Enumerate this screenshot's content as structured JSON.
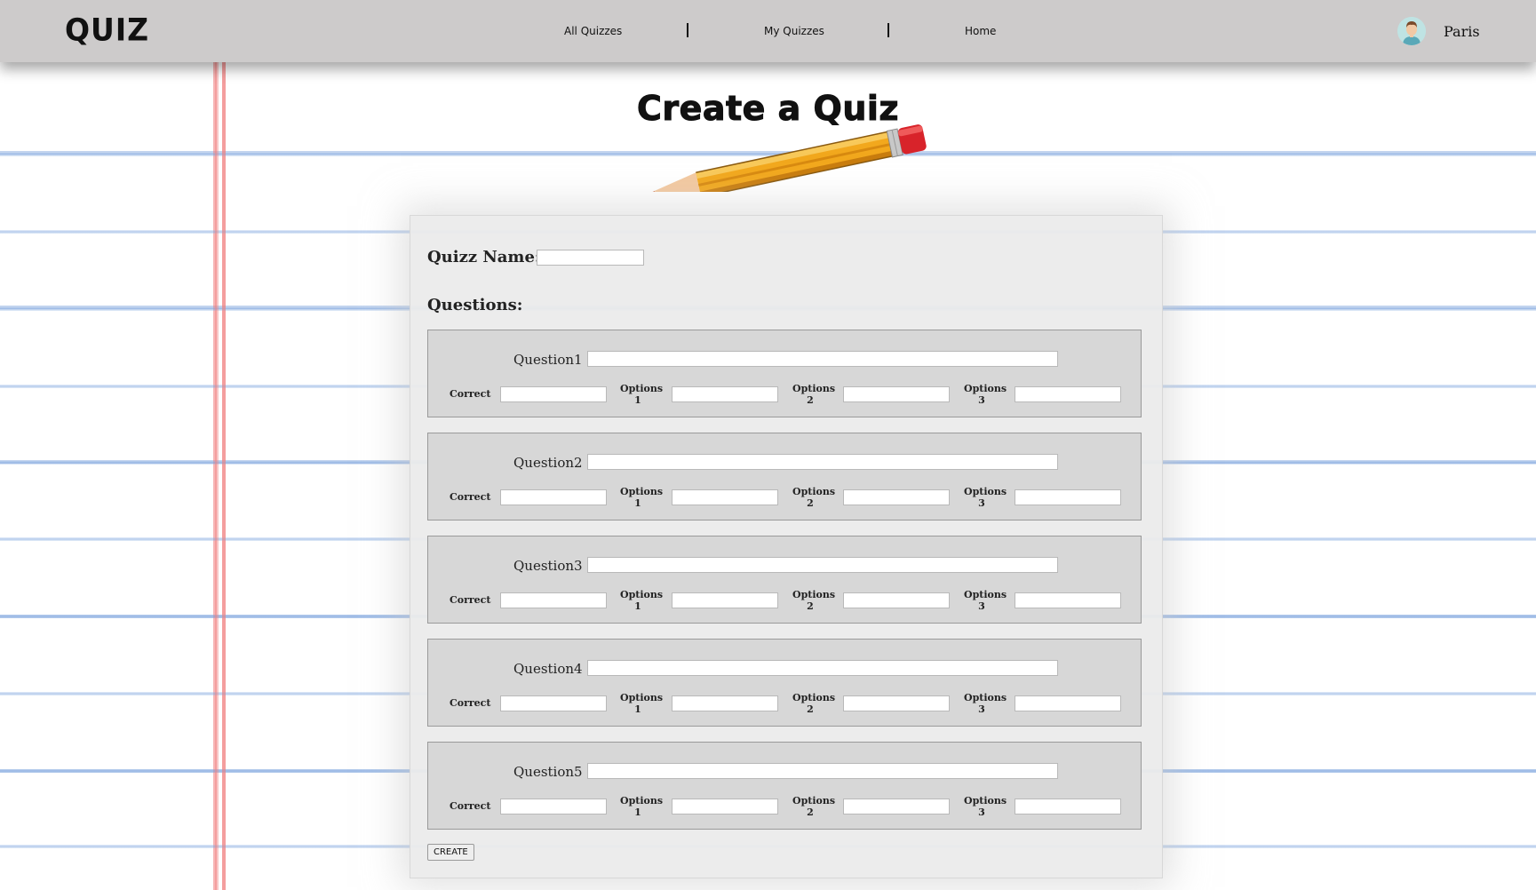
{
  "header": {
    "logo": "QUIZ",
    "nav": [
      {
        "label": "All Quizzes"
      },
      {
        "label": "My Quizzes"
      },
      {
        "label": "Home"
      }
    ],
    "user": {
      "name": "Paris"
    }
  },
  "page": {
    "title": "Create a Quiz"
  },
  "form": {
    "quiz_name_label": "Quizz Name:",
    "quiz_name_value": "",
    "questions_label": "Questions:",
    "questions": [
      {
        "label": "Question1",
        "correct_label": "Correct",
        "option1_label_a": "Options",
        "option1_label_b": "1",
        "option2_label_a": "Options",
        "option2_label_b": "2",
        "option3_label_a": "Options",
        "option3_label_b": "3"
      },
      {
        "label": "Question2",
        "correct_label": "Correct",
        "option1_label_a": "Options",
        "option1_label_b": "1",
        "option2_label_a": "Options",
        "option2_label_b": "2",
        "option3_label_a": "Options",
        "option3_label_b": "3"
      },
      {
        "label": "Question3",
        "correct_label": "Correct",
        "option1_label_a": "Options",
        "option1_label_b": "1",
        "option2_label_a": "Options",
        "option2_label_b": "2",
        "option3_label_a": "Options",
        "option3_label_b": "3"
      },
      {
        "label": "Question4",
        "correct_label": "Correct",
        "option1_label_a": "Options",
        "option1_label_b": "1",
        "option2_label_a": "Options",
        "option2_label_b": "2",
        "option3_label_a": "Options",
        "option3_label_b": "3"
      },
      {
        "label": "Question5",
        "correct_label": "Correct",
        "option1_label_a": "Options",
        "option1_label_b": "1",
        "option2_label_a": "Options",
        "option2_label_b": "2",
        "option3_label_a": "Options",
        "option3_label_b": "3"
      }
    ],
    "submit_label": "CREATE"
  },
  "icons": {
    "avatar": "user-avatar-icon",
    "pencil": "pencil-illustration"
  },
  "colors": {
    "navbar_bg": "#cdcbcb",
    "panel_bg": "#ebebeb",
    "question_box_bg": "#d7d7d7",
    "notebook_line": "#78a0dc",
    "margin_line": "#f07878"
  }
}
